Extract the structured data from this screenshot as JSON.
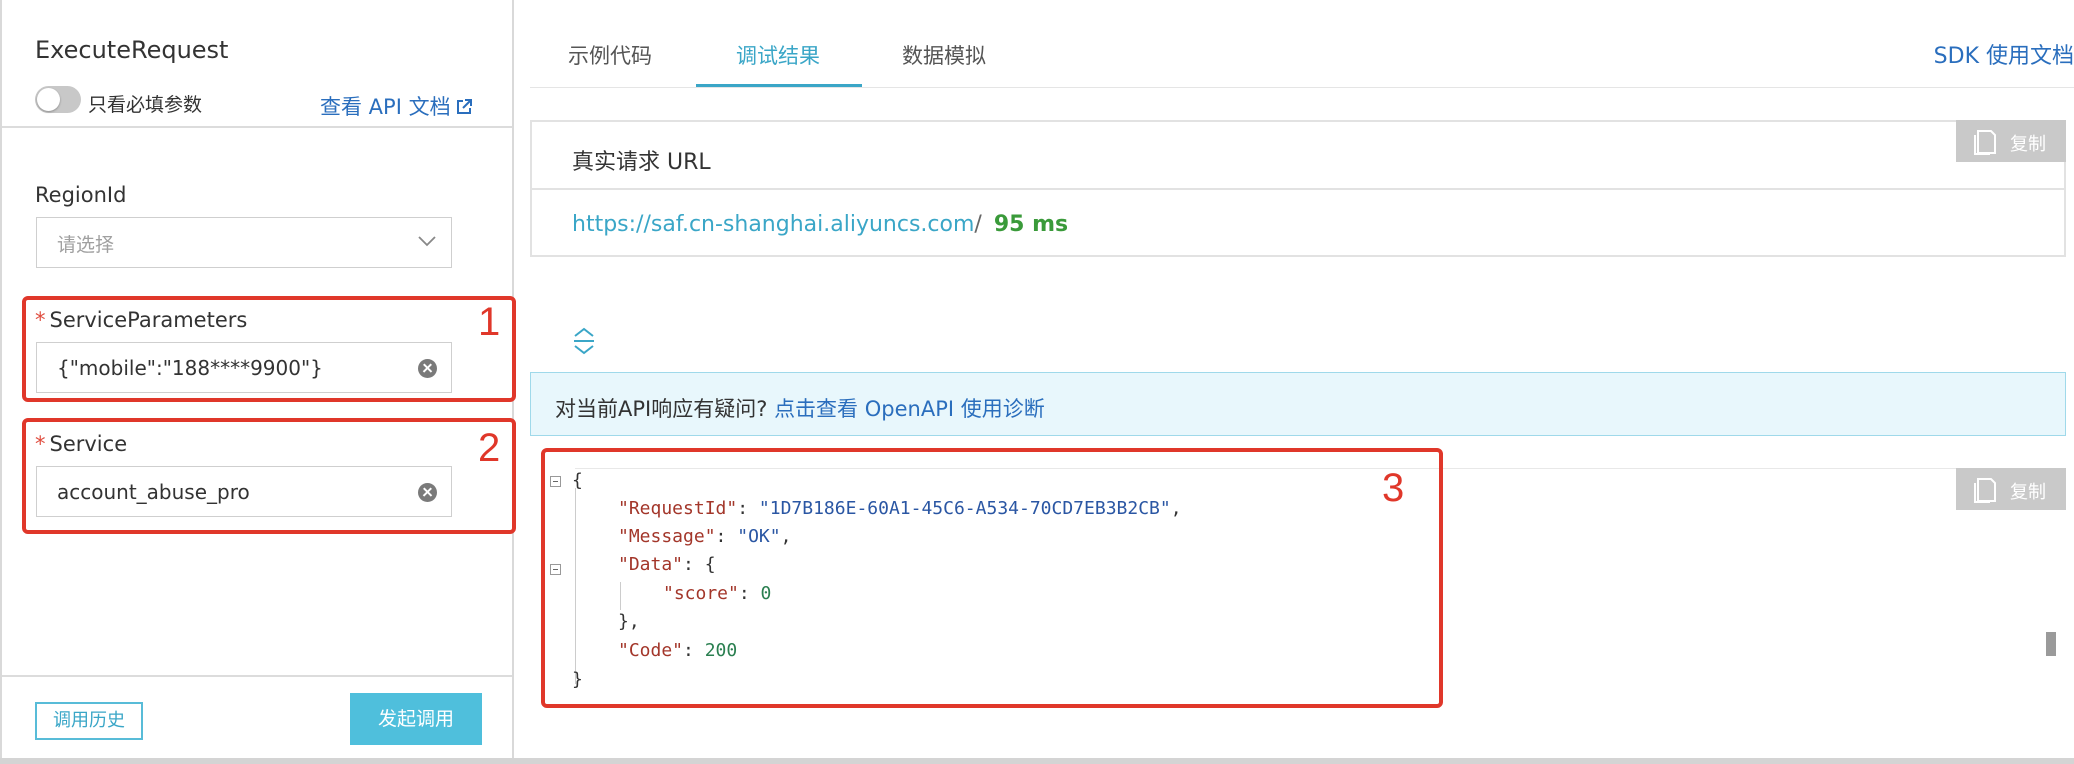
{
  "left": {
    "api_title": "ExecuteRequest",
    "toggle_label": "只看必填参数",
    "doc_link": "查看 API 文档",
    "fields": {
      "region": {
        "label": "RegionId",
        "placeholder": "请选择"
      },
      "service_parameters": {
        "required": "*",
        "label": "ServiceParameters",
        "value": "{\"mobile\":\"188****9900\"}"
      },
      "service": {
        "required": "*",
        "label": "Service",
        "value": "account_abuse_pro"
      }
    },
    "history_button": "调用历史",
    "invoke_button": "发起调用"
  },
  "annotations": {
    "one": "1",
    "two": "2",
    "three": "3"
  },
  "tabs": [
    {
      "label": "示例代码"
    },
    {
      "label": "调试结果"
    },
    {
      "label": "数据模拟"
    }
  ],
  "sdk_link": "SDK 使用文档",
  "request_url": {
    "title": "真实请求 URL",
    "url": "https://saf.cn-shanghai.aliyuncs.com",
    "slash": "/",
    "latency": "95 ms",
    "copy": "复制"
  },
  "notice": {
    "question": "对当前API响应有疑问?",
    "link": "点击查看 OpenAPI 使用诊断"
  },
  "response": {
    "copy": "复制",
    "open_brace": "{",
    "request_id_key": "\"RequestId\"",
    "request_id_val": "\"1D7B186E-60A1-45C6-A534-70CD7EB3B2CB\"",
    "message_key": "\"Message\"",
    "message_val": "\"OK\"",
    "data_key": "\"Data\"",
    "score_key": "\"score\"",
    "score_val": "0",
    "code_key": "\"Code\"",
    "code_val": "200",
    "close_brace": "}"
  },
  "colors": {
    "accent": "#3aa6c7",
    "link": "#2a6ebd",
    "annotation": "#e0372a",
    "success": "#3a9a3a"
  }
}
